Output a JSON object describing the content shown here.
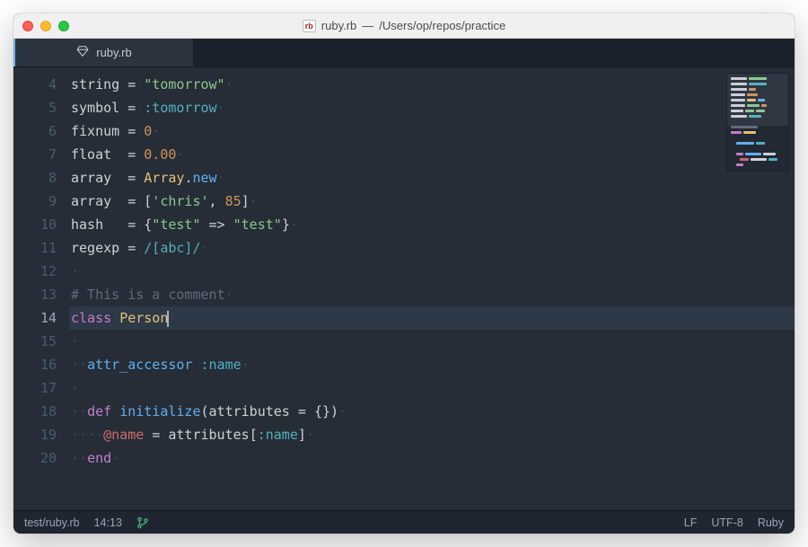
{
  "window": {
    "filename": "ruby.rb",
    "path": "/Users/op/repos/practice",
    "title_sep": " — ",
    "file_icon": "rb"
  },
  "tabs": [
    {
      "label": "ruby.rb",
      "icon": "ruby-diamond-icon",
      "active": true
    }
  ],
  "editor": {
    "first_visible_line": 4,
    "last_visible_line": 20,
    "active_line": 14,
    "cursor": {
      "line": 14,
      "col": 13
    },
    "lines": [
      {
        "n": 4,
        "tokens": [
          [
            "ident",
            "string"
          ],
          [
            "text",
            " "
          ],
          [
            "op",
            "="
          ],
          [
            "text",
            " "
          ],
          [
            "str",
            "\"tomorrow\""
          ]
        ]
      },
      {
        "n": 5,
        "tokens": [
          [
            "ident",
            "symbol"
          ],
          [
            "text",
            " "
          ],
          [
            "op",
            "="
          ],
          [
            "text",
            " "
          ],
          [
            "sym",
            ":tomorrow"
          ]
        ]
      },
      {
        "n": 6,
        "tokens": [
          [
            "ident",
            "fixnum"
          ],
          [
            "text",
            " "
          ],
          [
            "op",
            "="
          ],
          [
            "text",
            " "
          ],
          [
            "num",
            "0"
          ]
        ]
      },
      {
        "n": 7,
        "tokens": [
          [
            "ident",
            "float"
          ],
          [
            "text",
            "  "
          ],
          [
            "op",
            "="
          ],
          [
            "text",
            " "
          ],
          [
            "num",
            "0.00"
          ]
        ]
      },
      {
        "n": 8,
        "tokens": [
          [
            "ident",
            "array"
          ],
          [
            "text",
            "  "
          ],
          [
            "op",
            "="
          ],
          [
            "text",
            " "
          ],
          [
            "const",
            "Array"
          ],
          [
            "text",
            "."
          ],
          [
            "method",
            "new"
          ]
        ]
      },
      {
        "n": 9,
        "tokens": [
          [
            "ident",
            "array"
          ],
          [
            "text",
            "  "
          ],
          [
            "op",
            "="
          ],
          [
            "text",
            " "
          ],
          [
            "text",
            "["
          ],
          [
            "str",
            "'chris'"
          ],
          [
            "text",
            ", "
          ],
          [
            "num",
            "85"
          ],
          [
            "text",
            "]"
          ]
        ]
      },
      {
        "n": 10,
        "tokens": [
          [
            "ident",
            "hash"
          ],
          [
            "text",
            "   "
          ],
          [
            "op",
            "="
          ],
          [
            "text",
            " "
          ],
          [
            "text",
            "{"
          ],
          [
            "str",
            "\"test\""
          ],
          [
            "text",
            " "
          ],
          [
            "op",
            "=>"
          ],
          [
            "text",
            " "
          ],
          [
            "str",
            "\"test\""
          ],
          [
            "text",
            "}"
          ]
        ]
      },
      {
        "n": 11,
        "tokens": [
          [
            "ident",
            "regexp"
          ],
          [
            "text",
            " "
          ],
          [
            "op",
            "="
          ],
          [
            "text",
            " "
          ],
          [
            "regex",
            "/[abc]/"
          ]
        ]
      },
      {
        "n": 12,
        "tokens": []
      },
      {
        "n": 13,
        "tokens": [
          [
            "comment",
            "# This is a comment"
          ]
        ]
      },
      {
        "n": 14,
        "tokens": [
          [
            "kw",
            "class"
          ],
          [
            "text",
            " "
          ],
          [
            "const",
            "Person"
          ]
        ],
        "cursor_after": true
      },
      {
        "n": 15,
        "tokens": []
      },
      {
        "n": 16,
        "indent": 1,
        "tokens": [
          [
            "method",
            "attr_accessor"
          ],
          [
            "text",
            " "
          ],
          [
            "sym",
            ":name"
          ]
        ]
      },
      {
        "n": 17,
        "tokens": []
      },
      {
        "n": 18,
        "indent": 1,
        "tokens": [
          [
            "kw",
            "def"
          ],
          [
            "text",
            " "
          ],
          [
            "method",
            "initialize"
          ],
          [
            "text",
            "("
          ],
          [
            "ident",
            "attributes"
          ],
          [
            "text",
            " "
          ],
          [
            "op",
            "="
          ],
          [
            "text",
            " "
          ],
          [
            "text",
            "{}"
          ],
          [
            "text",
            ")"
          ]
        ]
      },
      {
        "n": 19,
        "indent": 2,
        "tokens": [
          [
            "ivar",
            "@name"
          ],
          [
            "text",
            " "
          ],
          [
            "op",
            "="
          ],
          [
            "text",
            " "
          ],
          [
            "ident",
            "attributes"
          ],
          [
            "text",
            "["
          ],
          [
            "sym",
            ":name"
          ],
          [
            "text",
            "]"
          ]
        ]
      },
      {
        "n": 20,
        "indent": 1,
        "tokens": [
          [
            "kw",
            "end"
          ]
        ]
      }
    ]
  },
  "status": {
    "filepath": "test/ruby.rb",
    "cursor_pos": "14:13",
    "line_ending": "LF",
    "encoding": "UTF-8",
    "language": "Ruby",
    "git_branch_icon": "git-branch-icon"
  },
  "colors": {
    "background": "#262d37",
    "keyword": "#c47cce",
    "string": "#8cc98d",
    "symbol": "#50b0be",
    "number": "#d0925a",
    "constant": "#e3c07a",
    "method": "#62afef",
    "comment": "#606b7b",
    "ivar": "#cf6a6a"
  }
}
